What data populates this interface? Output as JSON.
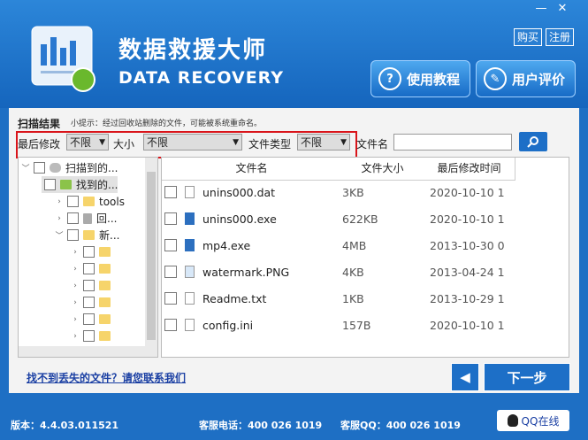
{
  "window": {
    "minimize": "—",
    "close": "✕"
  },
  "header": {
    "title_cn": "数据救援大师",
    "title_en": "DATA RECOVERY",
    "buy": "购买",
    "register": "注册",
    "tutorial": "使用教程",
    "review": "用户评价"
  },
  "scan": {
    "title": "扫描结果",
    "tip": "小提示：经过回收站删除的文件，可能被系统重命名。"
  },
  "filters": {
    "modified_label": "最后修改",
    "modified_value": "不限",
    "size_label": "大小",
    "size_value": "不限",
    "type_label": "文件类型",
    "type_value": "不限",
    "name_label": "文件名",
    "name_value": ""
  },
  "tree": [
    {
      "label": "扫描到的..."
    },
    {
      "label": "找到的..."
    },
    {
      "label": "tools"
    },
    {
      "label": "回..."
    },
    {
      "label": "新..."
    }
  ],
  "list": {
    "headers": {
      "name": "文件名",
      "size": "文件大小",
      "date": "最后修改时间"
    },
    "rows": [
      {
        "name": "unins000.dat",
        "size": "3KB",
        "date": "2020-10-10 1"
      },
      {
        "name": "unins000.exe",
        "size": "622KB",
        "date": "2020-10-10 1"
      },
      {
        "name": "mp4.exe",
        "size": "4MB",
        "date": "2013-10-30 0"
      },
      {
        "name": "watermark.PNG",
        "size": "4KB",
        "date": "2013-04-24 1"
      },
      {
        "name": "Readme.txt",
        "size": "1KB",
        "date": "2013-10-29 1"
      },
      {
        "name": "config.ini",
        "size": "157B",
        "date": "2020-10-10 1"
      }
    ]
  },
  "contact": "找不到丢失的文件？请您联系我们",
  "next": "下一步",
  "footer": {
    "version": "版本：4.4.03.011521",
    "phone": "客服电话：400 026 1019",
    "qq": "客服QQ：400 026 1019",
    "qq_online": "QQ在线"
  }
}
